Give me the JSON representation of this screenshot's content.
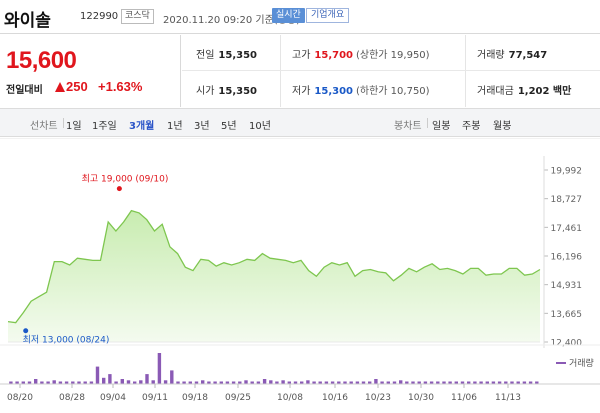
{
  "header": {
    "stock_name": "와이솔",
    "stock_code": "122990",
    "market": "코스닥",
    "datetime": "2020.11.20 09:20 기준(장중)",
    "realtime_label": "실시간",
    "corp_overview_label": "기업개요"
  },
  "price": {
    "current": "15,600",
    "change_label": "전일대비",
    "change": "250",
    "change_pct": "+1.63%",
    "colors": {
      "up": "#e0161d",
      "down": "#1a59c7"
    }
  },
  "stats": {
    "prev_close": {
      "label": "전일",
      "value": "15,350"
    },
    "high": {
      "label": "고가",
      "value": "15,700",
      "limit": "(상한가 19,950)"
    },
    "volume": {
      "label": "거래량",
      "value": "77,547"
    },
    "open": {
      "label": "시가",
      "value": "15,350"
    },
    "low": {
      "label": "저가",
      "value": "15,300",
      "limit": "(하한가 10,750)"
    },
    "trade_value": {
      "label": "거래대금",
      "value": "1,202 백만"
    }
  },
  "tabs": {
    "line_chart": "선차트",
    "periods": [
      "1일",
      "1주일",
      "3개월",
      "1년",
      "3년",
      "5년",
      "10년"
    ],
    "selected_period": "3개월",
    "candle_chart": "봉차트",
    "candles": [
      "일봉",
      "주봉",
      "월봉"
    ]
  },
  "chart_data": {
    "type": "area",
    "series": [
      {
        "values": [
          13300,
          13250,
          13700,
          14200,
          14400,
          14600,
          15950,
          15950,
          15800,
          16100,
          16050,
          16000,
          16000,
          17700,
          17300,
          17700,
          18200,
          18100,
          17800,
          17300,
          17600,
          16600,
          16300,
          15700,
          15550,
          16050,
          16000,
          15750,
          15900,
          15800,
          15900,
          16050,
          16000,
          16300,
          16100,
          16050,
          16000,
          15900,
          16000,
          15550,
          15300,
          15700,
          15900,
          15800,
          15900,
          15300,
          15550,
          15600,
          15500,
          15450,
          15100,
          15350,
          15650,
          15500,
          15700,
          15850,
          15600,
          15650,
          15550,
          15400,
          15650,
          15650,
          15350,
          15400,
          15400,
          15650,
          15650,
          15350,
          15400,
          15600
        ]
      }
    ],
    "volume": [
      2,
      2,
      2,
      2,
      4,
      2,
      2,
      3,
      2,
      2,
      2,
      2,
      2,
      2,
      14,
      5,
      8,
      2,
      4,
      3,
      2,
      3,
      8,
      3,
      25,
      3,
      11,
      2,
      2,
      2,
      2,
      3,
      2,
      2,
      2,
      2,
      2,
      2,
      3,
      2,
      2,
      4,
      3,
      2,
      3,
      2,
      2,
      2,
      3,
      2,
      2,
      2,
      2,
      2,
      2,
      2,
      2,
      2,
      2,
      4,
      2,
      2,
      2,
      3,
      2,
      2,
      2,
      2,
      2,
      2,
      2,
      2,
      2,
      2,
      2,
      2,
      2,
      2,
      2,
      2,
      2,
      2,
      2,
      2,
      2,
      2
    ],
    "x_labels": [
      "08/20",
      "08/28",
      "09/04",
      "09/11",
      "09/18",
      "09/25",
      "10/08",
      "10/16",
      "10/23",
      "10/30",
      "11/06",
      "11/13"
    ],
    "y_ticks": [
      19992,
      18727,
      17461,
      16196,
      14931,
      13665,
      12400
    ],
    "y_tick_labels": [
      "19,992",
      "18,727",
      "17,461",
      "16,196",
      "14,931",
      "13,665",
      "12,400"
    ],
    "ylim": [
      12400,
      19992
    ],
    "max_annotation": "최고 19,000 (09/10)",
    "min_annotation": "최저 13,000 (08/24)",
    "volume_legend": "거래량",
    "colors": {
      "line": "#7ec64f",
      "area_top": "#c8ecb0",
      "area_bottom": "#f4fbef",
      "volume": "#8a5ab5",
      "max_dot": "#e0161d",
      "min_dot": "#1a59c7"
    }
  }
}
